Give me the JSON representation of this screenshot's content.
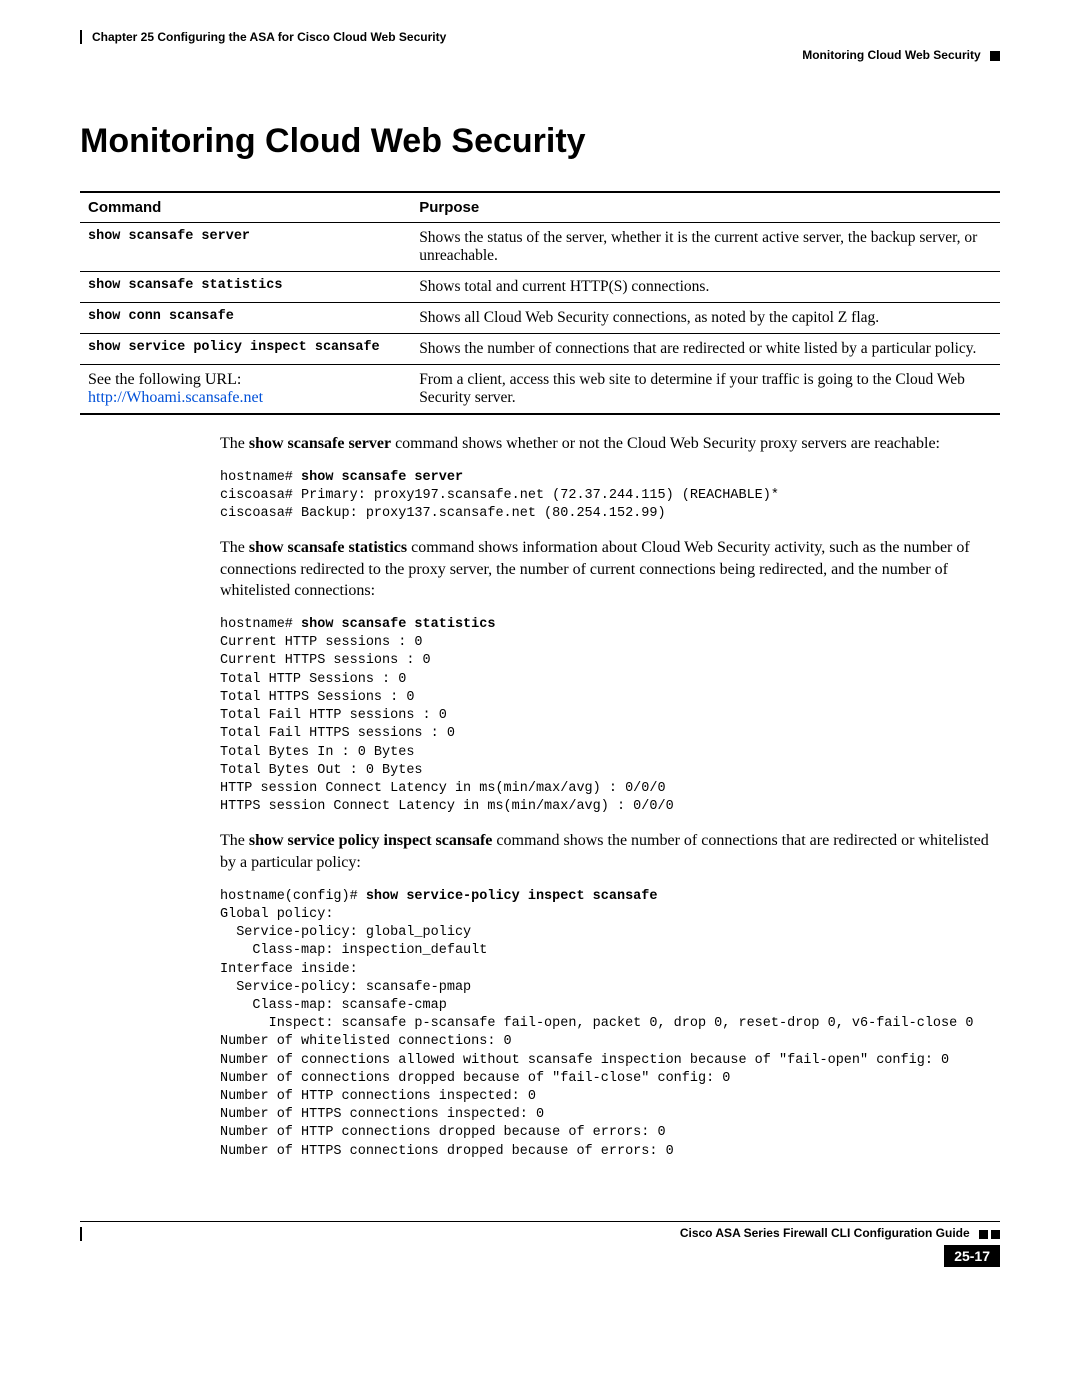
{
  "header": {
    "chapter": "Chapter 25    Configuring the ASA for Cisco Cloud Web Security",
    "running": "Monitoring Cloud Web Security"
  },
  "title": "Monitoring Cloud Web Security",
  "table": {
    "head_command": "Command",
    "head_purpose": "Purpose",
    "rows": [
      {
        "cmd": "show scansafe server",
        "cmd_is_code": true,
        "purpose": "Shows the status of the server, whether it is the current active server, the backup server, or unreachable."
      },
      {
        "cmd": "show scansafe statistics",
        "cmd_is_code": true,
        "purpose": "Shows total and current HTTP(S) connections."
      },
      {
        "cmd": "show conn scansafe",
        "cmd_is_code": true,
        "purpose": "Shows all Cloud Web Security connections, as noted by the capitol Z flag."
      },
      {
        "cmd": "show service policy inspect scansafe",
        "cmd_is_code": true,
        "purpose": "Shows the number of connections that are redirected or white listed by a particular policy."
      },
      {
        "cmd_prefix": "See the following URL:",
        "cmd_link": "http://Whoami.scansafe.net",
        "cmd_is_code": false,
        "purpose": "From a client, access this web site to determine if your traffic is going to the Cloud Web Security server."
      }
    ]
  },
  "paragraphs": {
    "p1_pre": "The ",
    "p1_bold": "show scansafe server",
    "p1_post": " command shows whether or not the Cloud Web Security proxy servers are reachable:",
    "code1_prompt": "hostname# ",
    "code1_cmd": "show scansafe server",
    "code1_body": "ciscoasa# Primary: proxy197.scansafe.net (72.37.244.115) (REACHABLE)*\nciscoasa# Backup: proxy137.scansafe.net (80.254.152.99)",
    "p2_pre": "The ",
    "p2_bold": "show scansafe statistics",
    "p2_post": " command shows information about Cloud Web Security activity, such as the number of connections redirected to the proxy server, the number of current connections being redirected, and the number of whitelisted connections:",
    "code2_prompt": "hostname# ",
    "code2_cmd": "show scansafe statistics",
    "code2_body": "Current HTTP sessions : 0\nCurrent HTTPS sessions : 0\nTotal HTTP Sessions : 0\nTotal HTTPS Sessions : 0\nTotal Fail HTTP sessions : 0\nTotal Fail HTTPS sessions : 0\nTotal Bytes In : 0 Bytes\nTotal Bytes Out : 0 Bytes\nHTTP session Connect Latency in ms(min/max/avg) : 0/0/0\nHTTPS session Connect Latency in ms(min/max/avg) : 0/0/0",
    "p3_pre": "The ",
    "p3_bold": "show service policy inspect scansafe",
    "p3_post": " command shows the number of connections that are redirected or whitelisted by a particular policy:",
    "code3_prompt": "hostname(config)# ",
    "code3_cmd": "show service-policy inspect scansafe",
    "code3_body": "Global policy:\n  Service-policy: global_policy\n    Class-map: inspection_default\nInterface inside:\n  Service-policy: scansafe-pmap\n    Class-map: scansafe-cmap\n      Inspect: scansafe p-scansafe fail-open, packet 0, drop 0, reset-drop 0, v6-fail-close 0\nNumber of whitelisted connections: 0\nNumber of connections allowed without scansafe inspection because of \"fail-open\" config: 0\nNumber of connections dropped because of \"fail-close\" config: 0\nNumber of HTTP connections inspected: 0\nNumber of HTTPS connections inspected: 0\nNumber of HTTP connections dropped because of errors: 0\nNumber of HTTPS connections dropped because of errors: 0"
  },
  "footer": {
    "guide": "Cisco ASA Series Firewall CLI Configuration Guide",
    "page": "25-17"
  }
}
